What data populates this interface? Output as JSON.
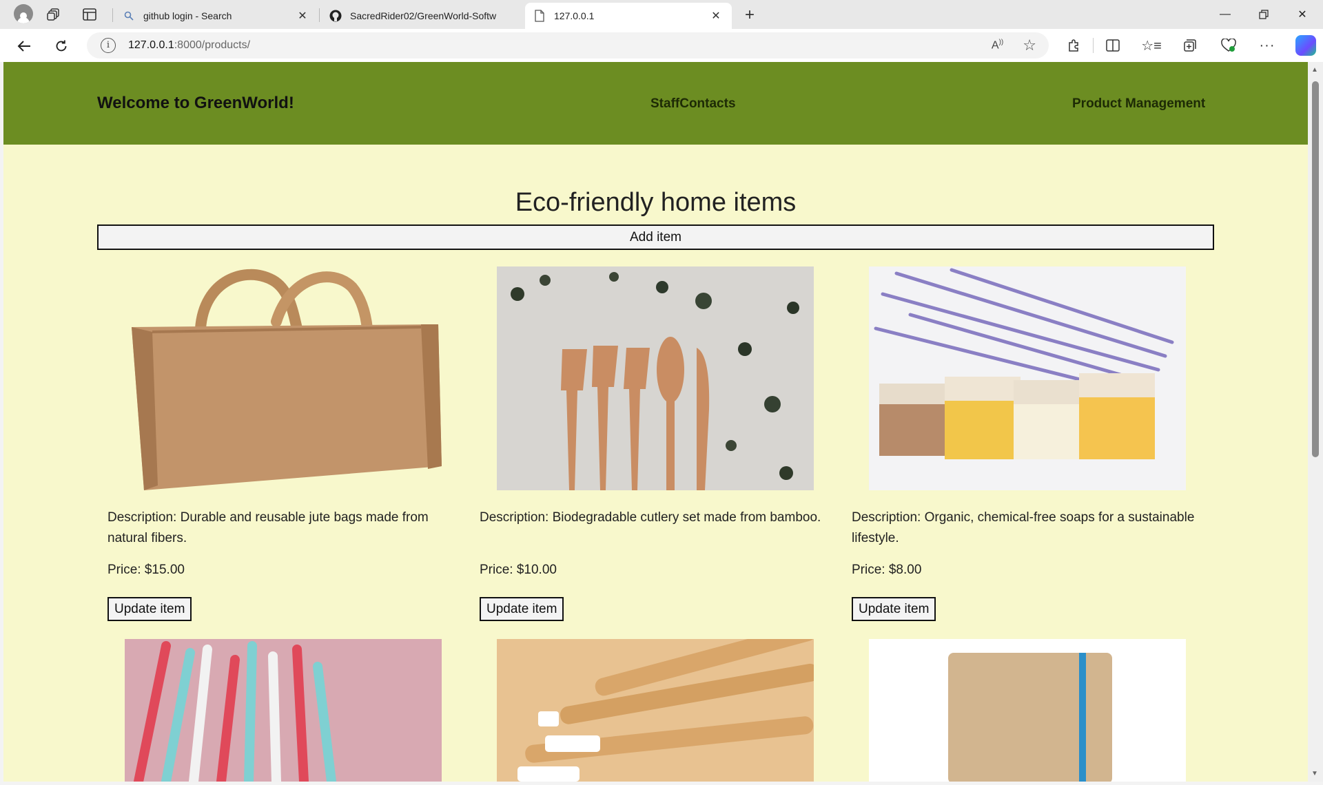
{
  "browser": {
    "tabs": [
      {
        "title": "github login - Search",
        "favicon": "search-icon"
      },
      {
        "title": "SacredRider02/GreenWorld-Softw",
        "favicon": "github-icon"
      },
      {
        "title": "127.0.0.1",
        "favicon": "page-icon"
      }
    ],
    "url_host": "127.0.0.1",
    "url_path": ":8000/products/"
  },
  "site": {
    "brand": "Welcome to GreenWorld!",
    "nav": [
      "StaffContacts",
      "Product Management"
    ],
    "page_title": "Eco-friendly home items",
    "add_label": "Add item"
  },
  "products": [
    {
      "description": "Description: Durable and reusable jute bags made from natural fibers.",
      "price": "Price: $15.00",
      "update_label": "Update item",
      "image": "jute-bag"
    },
    {
      "description": "Description: Biodegradable cutlery set made from bamboo.",
      "price": "Price: $10.00",
      "update_label": "Update item",
      "image": "bamboo-cutlery"
    },
    {
      "description": "Description: Organic, chemical-free soaps for a sustainable lifestyle.",
      "price": "Price: $8.00",
      "update_label": "Update item",
      "image": "organic-soaps"
    },
    {
      "image": "paper-straws"
    },
    {
      "image": "bamboo-toothbrushes"
    },
    {
      "image": "kraft-notebook"
    }
  ],
  "colors": {
    "header": "#6c8d22",
    "page_bg": "#f8f8cc"
  }
}
